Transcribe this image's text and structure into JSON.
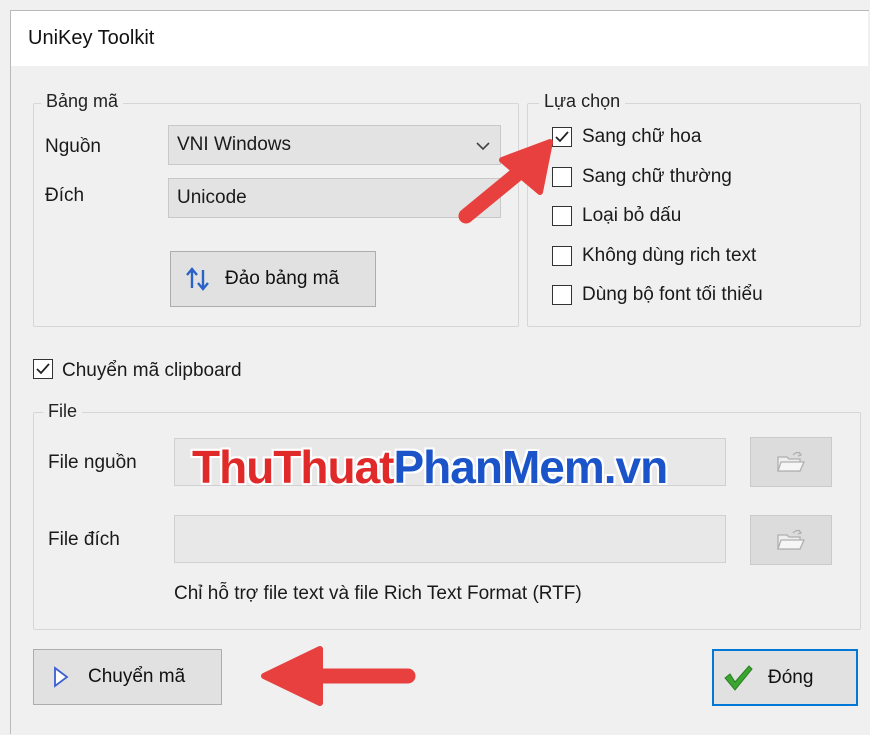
{
  "window": {
    "title": "UniKey Toolkit"
  },
  "bang_ma": {
    "legend": "Bảng mã",
    "source_label": "Nguồn",
    "source_value": "VNI Windows",
    "dest_label": "Đích",
    "dest_value": "Unicode",
    "swap_button": "Đảo bảng mã"
  },
  "options": {
    "legend": "Lựa chọn",
    "items": [
      {
        "label": "Sang chữ hoa",
        "checked": true
      },
      {
        "label": "Sang chữ thường",
        "checked": false
      },
      {
        "label": "Loại bỏ dấu",
        "checked": false
      },
      {
        "label": "Không dùng rich text",
        "checked": false
      },
      {
        "label": "Dùng bộ font tối thiểu",
        "checked": false
      }
    ]
  },
  "clipboard": {
    "label": "Chuyển mã clipboard",
    "checked": true
  },
  "file": {
    "legend": "File",
    "source_label": "File nguồn",
    "dest_label": "File đích",
    "note": "Chỉ hỗ trợ file text và file Rich Text Format (RTF)"
  },
  "watermark": {
    "part1": "ThuThuat",
    "part2": "PhanMem.vn"
  },
  "buttons": {
    "convert": "Chuyển mã",
    "close": "Đóng"
  },
  "colors": {
    "arrow": "#e8403f",
    "close_border": "#0078d7",
    "check_green": "#3aa62f"
  }
}
